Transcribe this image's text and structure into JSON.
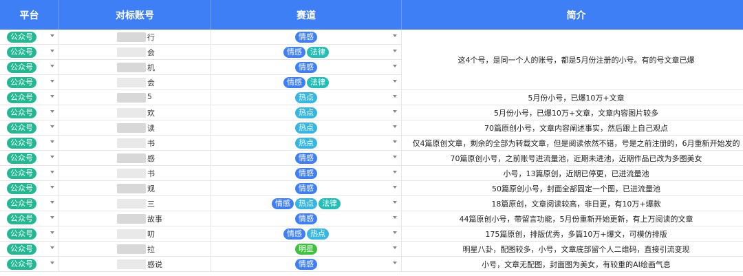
{
  "headers": {
    "platform": "平台",
    "account": "对标账号",
    "track": "赛道",
    "intro": "简介"
  },
  "tag_colors": {
    "情感": "#3f7ff5",
    "法律": "#22bdb5",
    "热点": "#36b6e3",
    "明星": "#3ec23e"
  },
  "platform_color": "#23b891",
  "rows": [
    {
      "platform": "公众号",
      "account_suffix": "行",
      "tags": [
        "情感"
      ]
    },
    {
      "platform": "公众号",
      "account_suffix": "会",
      "tags": [
        "情感",
        "法律"
      ]
    },
    {
      "platform": "公众号",
      "account_suffix": "机",
      "tags": [
        "情感"
      ]
    },
    {
      "platform": "公众号",
      "account_suffix": "会",
      "tags": [
        "情感",
        "法律"
      ]
    },
    {
      "platform": "公众号",
      "account_suffix": "5",
      "tags": [
        "热点"
      ],
      "intro": "5月份小号，已爆10万+文章"
    },
    {
      "platform": "公众号",
      "account_suffix": "欢",
      "tags": [
        "热点"
      ],
      "intro": "5月份小号，已爆10万+文章，文章内容图片较多"
    },
    {
      "platform": "公众号",
      "account_suffix": "读",
      "tags": [
        "热点"
      ],
      "intro": "70篇原创小号，文章内容阐述事实，然后跟上自己观点"
    },
    {
      "platform": "公众号",
      "account_suffix": "书",
      "tags": [
        "热点"
      ],
      "intro": "仅4篇原创文章，剩余的全部为转载文章，但是阅读依然不错，号是之前注册的，6月重新开始发的"
    },
    {
      "platform": "公众号",
      "account_suffix": "感",
      "tags": [
        "情感"
      ],
      "intro": "70篇原创小号，之前账号进流量池，近期未进池，近期作品已改为多图美女"
    },
    {
      "platform": "公众号",
      "account_suffix": "书",
      "tags": [
        "情感"
      ],
      "intro": "小号，13篇原创，近期已停更，已进流量池"
    },
    {
      "platform": "公众号",
      "account_suffix": "观",
      "tags": [
        "情感"
      ],
      "intro": "50篇原创小号，封面全部固定一个图，已进流量池"
    },
    {
      "platform": "公众号",
      "account_suffix": "三",
      "tags": [
        "情感",
        "热点",
        "法律"
      ],
      "intro": "18篇原创，文章阅读较高，非日更，有10万+爆款"
    },
    {
      "platform": "公众号",
      "account_suffix": "故事",
      "tags": [
        "情感"
      ],
      "intro": "44篇原创小号，带留言功能，5月份重新开始更新，有上万阅读的文章"
    },
    {
      "platform": "公众号",
      "account_suffix": "叨",
      "tags": [
        "情感",
        "热点"
      ],
      "intro": "175篇原创，排版优秀，多篇10万+爆文，可模仿排版"
    },
    {
      "platform": "公众号",
      "account_suffix": "拉",
      "tags": [
        "明星"
      ],
      "intro": "明星八卦，配图较多，小号，文章底部留个人二维码，直接引流变现"
    },
    {
      "platform": "公众号",
      "account_suffix": "感说",
      "tags": [
        "情感"
      ],
      "intro": "小号，文章无配图，封面图为美女，有较重的AI绘画气息"
    }
  ],
  "merged_intro": "这4个号，是同一个人的账号，都是5月份注册的小号。有的号文章已爆"
}
